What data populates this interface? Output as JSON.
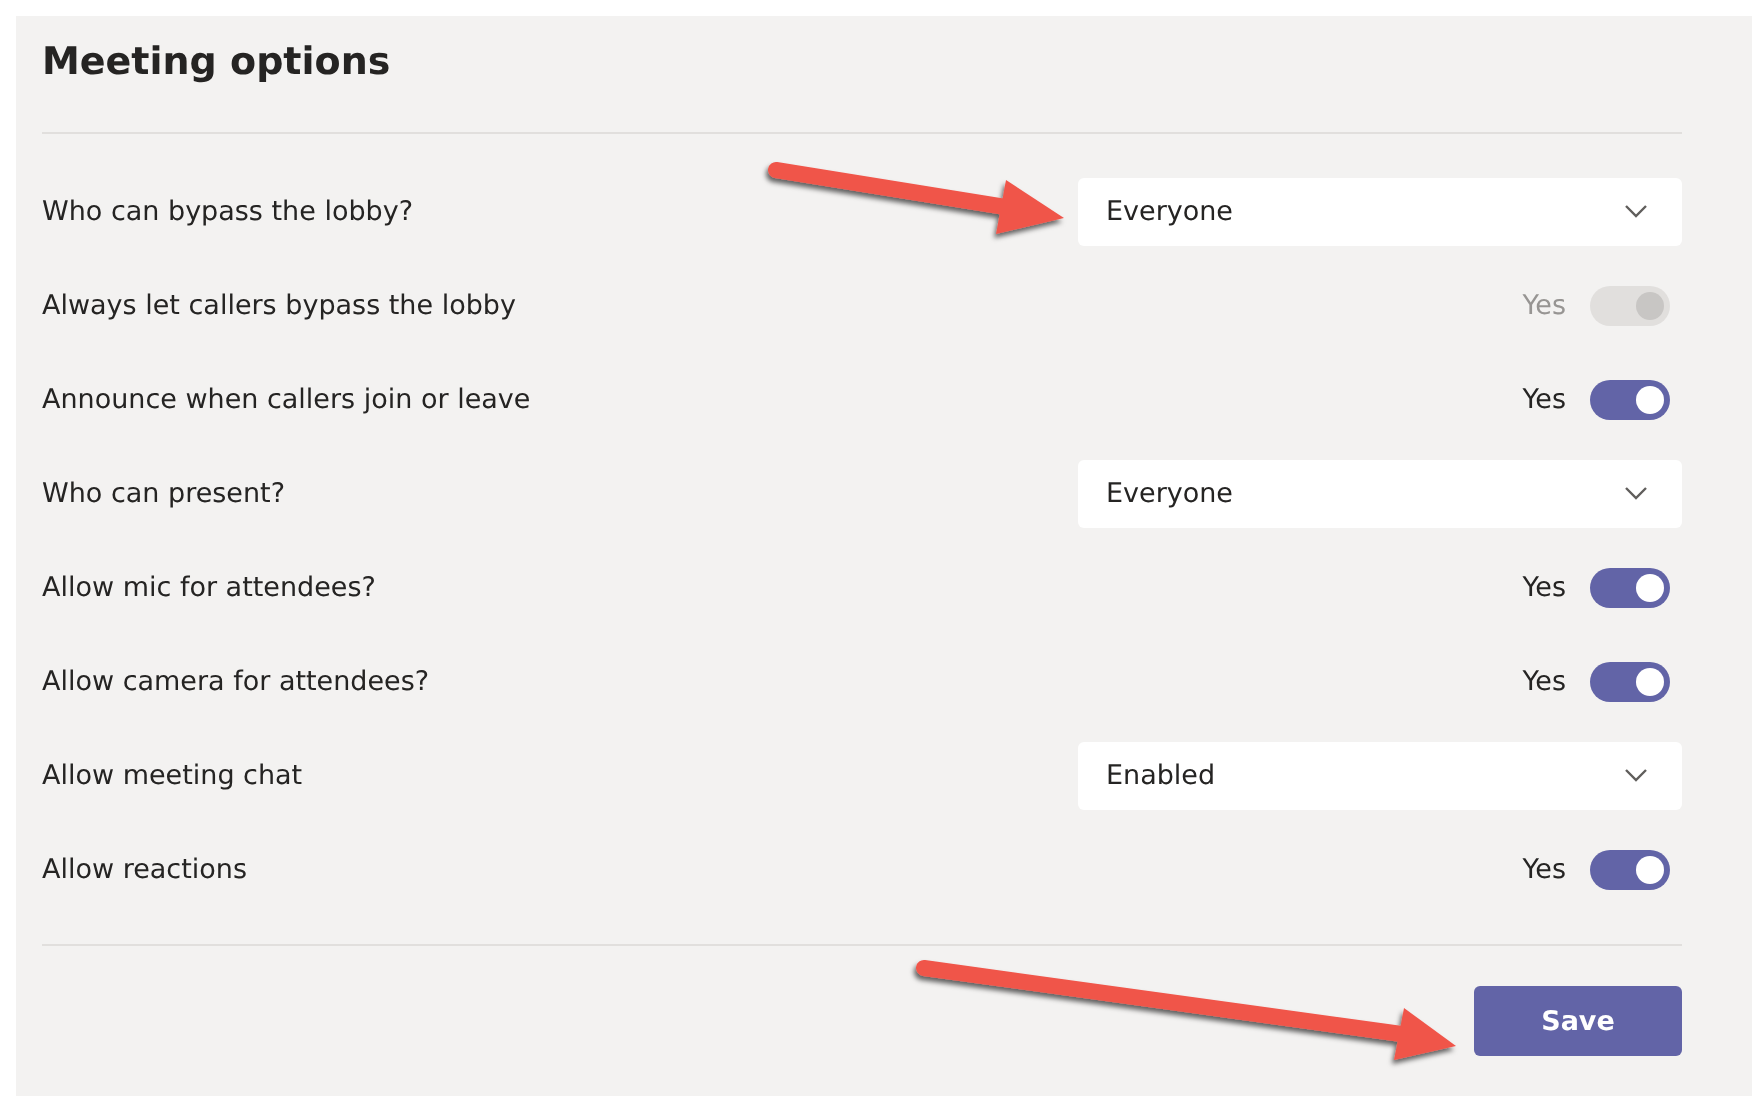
{
  "title": "Meeting options",
  "rows": [
    {
      "kind": "dropdown",
      "label": "Who can bypass the lobby?",
      "value": "Everyone"
    },
    {
      "kind": "toggle",
      "label": "Always let callers bypass the lobby",
      "state_label": "Yes",
      "on": true,
      "disabled": true
    },
    {
      "kind": "toggle",
      "label": "Announce when callers join or leave",
      "state_label": "Yes",
      "on": true,
      "disabled": false
    },
    {
      "kind": "dropdown",
      "label": "Who can present?",
      "value": "Everyone"
    },
    {
      "kind": "toggle",
      "label": "Allow mic for attendees?",
      "state_label": "Yes",
      "on": true,
      "disabled": false
    },
    {
      "kind": "toggle",
      "label": "Allow camera for attendees?",
      "state_label": "Yes",
      "on": true,
      "disabled": false
    },
    {
      "kind": "dropdown",
      "label": "Allow meeting chat",
      "value": "Enabled"
    },
    {
      "kind": "toggle",
      "label": "Allow reactions",
      "state_label": "Yes",
      "on": true,
      "disabled": false
    }
  ],
  "save_button": "Save"
}
